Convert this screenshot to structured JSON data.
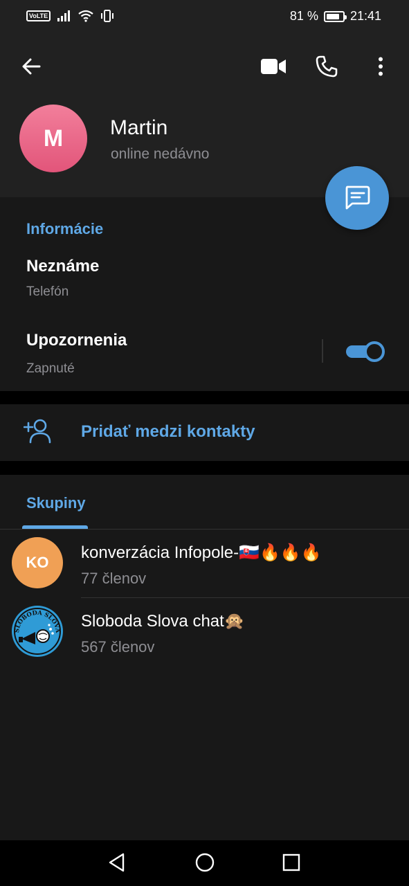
{
  "status_bar": {
    "volte": "VoLTE",
    "battery_text": "81 %",
    "battery_level": 0.81,
    "time": "21:41"
  },
  "header": {
    "avatar_initial": "M",
    "name": "Martin",
    "presence": "online nedávno",
    "icons": [
      "back-arrow-icon",
      "video-camera-icon",
      "phone-icon",
      "more-vert-icon"
    ]
  },
  "fab": {
    "icon": "message-icon"
  },
  "info": {
    "title": "Informácie",
    "phone_value": "Neznáme",
    "phone_label": "Telefón",
    "notifications_title": "Upozornenia",
    "notifications_status": "Zapnuté",
    "notifications_on": true
  },
  "add_contact": {
    "label": "Pridať medzi kontakty",
    "icon": "add-person-icon"
  },
  "groups": {
    "tab": "Skupiny",
    "items": [
      {
        "initials": "KO",
        "name": "konverzácia Infopole-🇸🇰🔥🔥🔥",
        "members": "77 členov",
        "avatar_color": "#f0a055"
      },
      {
        "initials": "",
        "name": "Sloboda Slova chat🙊",
        "members": "567 členov",
        "avatar_color": "#2f9bd6",
        "avatar_text": "SLOBODA SLOVA"
      }
    ]
  },
  "colors": {
    "accent": "#5fa8e6",
    "fab": "#4a95d6",
    "header_bg": "#212121",
    "section_bg": "#181818",
    "avatar_pink": "#e2557a"
  }
}
